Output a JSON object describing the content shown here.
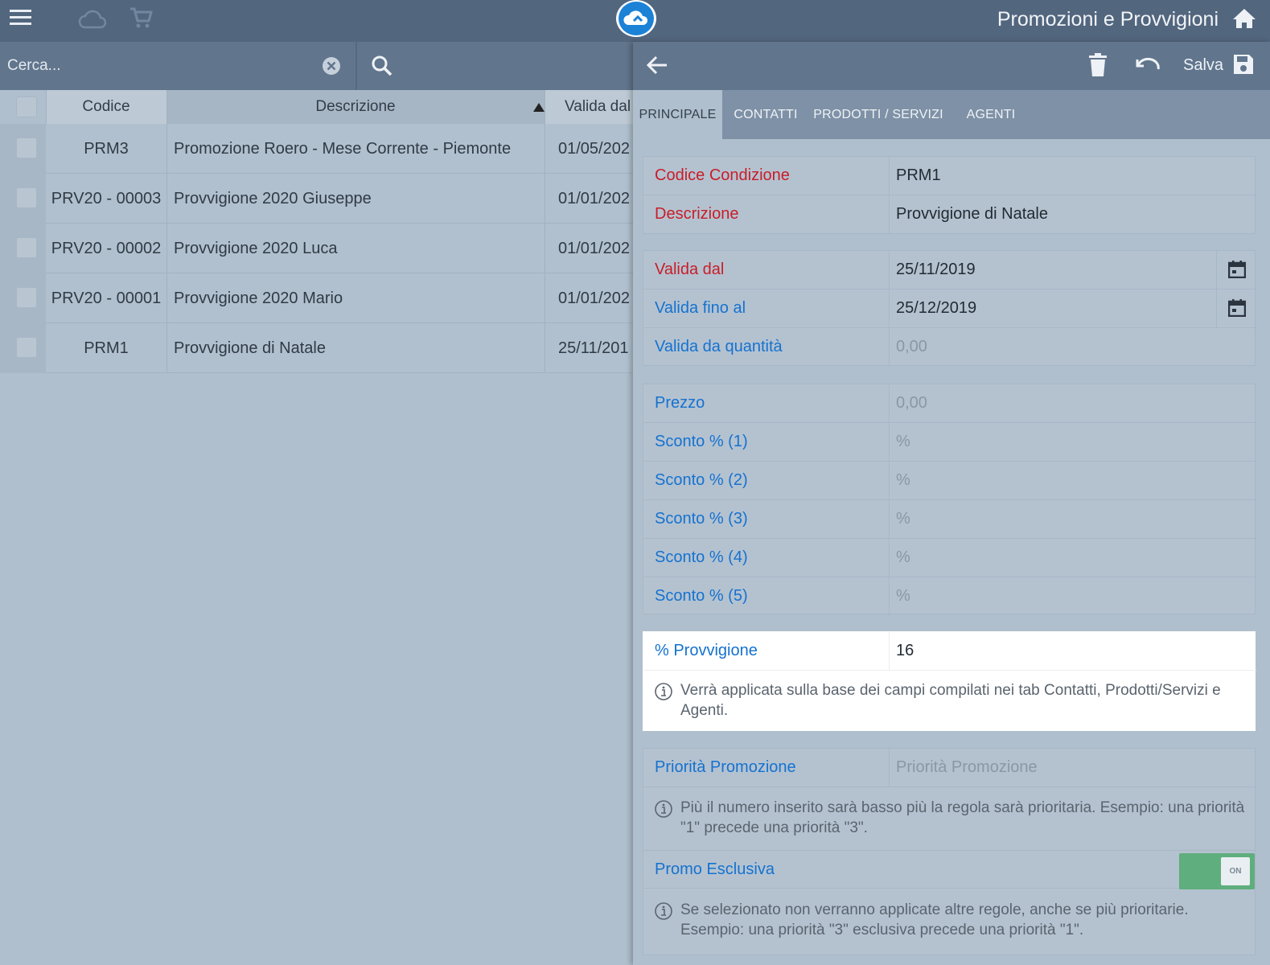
{
  "app": {
    "title": "Promozioni e Provvigioni"
  },
  "search": {
    "placeholder": "Cerca..."
  },
  "table": {
    "headers": {
      "code": "Codice",
      "description": "Descrizione",
      "valid_from": "Valida dal"
    },
    "rows": [
      {
        "code": "PRM3",
        "description": "Promozione Roero - Mese Corrente - Piemonte",
        "valid_from": "01/05/202"
      },
      {
        "code": "PRV20 - 00003",
        "description": "Provvigione 2020 Giuseppe",
        "valid_from": "01/01/202"
      },
      {
        "code": "PRV20 - 00002",
        "description": "Provvigione 2020 Luca",
        "valid_from": "01/01/202"
      },
      {
        "code": "PRV20 - 00001",
        "description": "Provvigione 2020 Mario",
        "valid_from": "01/01/202"
      },
      {
        "code": "PRM1",
        "description": "Provvigione di Natale",
        "valid_from": "25/11/201"
      }
    ]
  },
  "detail": {
    "save_label": "Salva",
    "tabs": [
      "PRINCIPALE",
      "CONTATTI",
      "PRODOTTI / SERVIZI",
      "AGENTI"
    ],
    "active_tab": "PRINCIPALE",
    "fields": {
      "codice_condizione": {
        "label": "Codice Condizione",
        "value": "PRM1"
      },
      "descrizione": {
        "label": "Descrizione",
        "value": "Provvigione di Natale"
      },
      "valida_dal": {
        "label": "Valida dal",
        "value": "25/11/2019"
      },
      "valida_fino_al": {
        "label": "Valida fino al",
        "value": "25/12/2019"
      },
      "valida_da_quantita": {
        "label": "Valida da quantità",
        "placeholder": "0,00"
      },
      "prezzo": {
        "label": "Prezzo",
        "placeholder": "0,00"
      },
      "sconto1": {
        "label": "Sconto % (1)",
        "placeholder": "%"
      },
      "sconto2": {
        "label": "Sconto % (2)",
        "placeholder": "%"
      },
      "sconto3": {
        "label": "Sconto % (3)",
        "placeholder": "%"
      },
      "sconto4": {
        "label": "Sconto % (4)",
        "placeholder": "%"
      },
      "sconto5": {
        "label": "Sconto % (5)",
        "placeholder": "%"
      },
      "provvigione": {
        "label": "% Provvigione",
        "value": "16",
        "hint": "Verrà applicata sulla base dei campi compilati nei tab Contatti, Prodotti/Servizi e Agenti."
      },
      "priorita": {
        "label": "Priorità Promozione",
        "placeholder": "Priorità Promozione",
        "hint": "Più il numero inserito sarà basso più la regola sarà prioritaria. Esempio: una priorità \"1\" precede una priorità \"3\"."
      },
      "promo_esclusiva": {
        "label": "Promo Esclusiva",
        "toggle": "ON",
        "hint": "Se selezionato non verranno applicate altre regole, anche se più prioritarie. Esempio: una priorità \"3\" esclusiva precede una priorità \"1\"."
      }
    }
  },
  "colors": {
    "topbar": "#52667e",
    "toolbar": "#61758d",
    "required_label": "#c81e28",
    "label": "#1572cf",
    "toggle_on": "#5fae7d"
  },
  "icons": [
    "menu-icon",
    "cloud-icon",
    "cart-icon",
    "app-logo-icon",
    "home-icon",
    "clear-icon",
    "search-icon",
    "back-arrow-icon",
    "trash-icon",
    "undo-icon",
    "save-icon",
    "calendar-icon",
    "info-icon"
  ]
}
